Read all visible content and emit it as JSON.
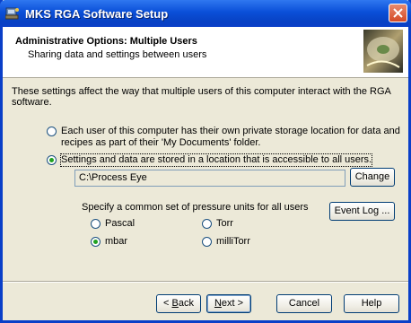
{
  "window": {
    "title": "MKS RGA Software Setup"
  },
  "header": {
    "title": "Administrative Options: Multiple Users",
    "subtitle": "Sharing data and settings between users"
  },
  "intro_text": "These settings affect the way that multiple users of this computer interact with the RGA software.",
  "storage_options": [
    {
      "line1": "Each user of this computer has their own private storage location for data and",
      "line2": "recipes as part of their 'My Documents' folder.",
      "selected": false
    },
    {
      "label": "Settings and data are stored in a location that is accessible to all users.",
      "selected": true
    }
  ],
  "shared_path": {
    "value": "C:\\Process Eye"
  },
  "change_button": "Change",
  "pressure_units": {
    "label": "Specify a common set of pressure units for all users",
    "options": [
      {
        "label": "Pascal",
        "selected": false
      },
      {
        "label": "Torr",
        "selected": false
      },
      {
        "label": "mbar",
        "selected": true
      },
      {
        "label": "milliTorr",
        "selected": false
      }
    ]
  },
  "event_log_button": "Event Log ...",
  "nav": {
    "back_prefix": "< ",
    "back_key": "B",
    "back_rest": "ack",
    "next_key": "N",
    "next_rest": "ext >",
    "cancel": "Cancel",
    "help": "Help"
  }
}
